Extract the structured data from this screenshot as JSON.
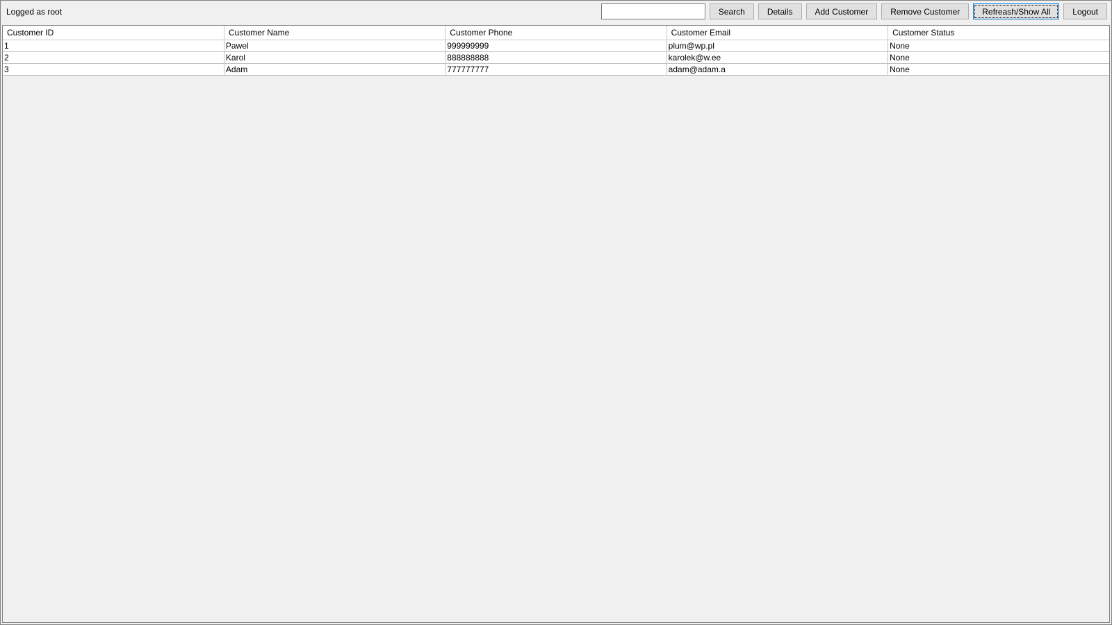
{
  "toolbar": {
    "status_label": "Logged as root",
    "search_value": "",
    "search_placeholder": "",
    "search_btn": "Search",
    "details_btn": "Details",
    "add_btn": "Add Customer",
    "remove_btn": "Remove Customer",
    "refresh_btn": "Refreash/Show All",
    "logout_btn": "Logout"
  },
  "table": {
    "columns": {
      "id": "Customer ID",
      "name": "Customer Name",
      "phone": "Customer Phone",
      "email": "Customer Email",
      "status": "Customer Status"
    },
    "rows": [
      {
        "id": "1",
        "name": "Pawel",
        "phone": "999999999",
        "email": "plum@wp.pl",
        "status": "None"
      },
      {
        "id": "2",
        "name": "Karol",
        "phone": "888888888",
        "email": "karolek@w.ee",
        "status": "None"
      },
      {
        "id": "3",
        "name": "Adam",
        "phone": "777777777",
        "email": "adam@adam.a",
        "status": "None"
      }
    ]
  }
}
